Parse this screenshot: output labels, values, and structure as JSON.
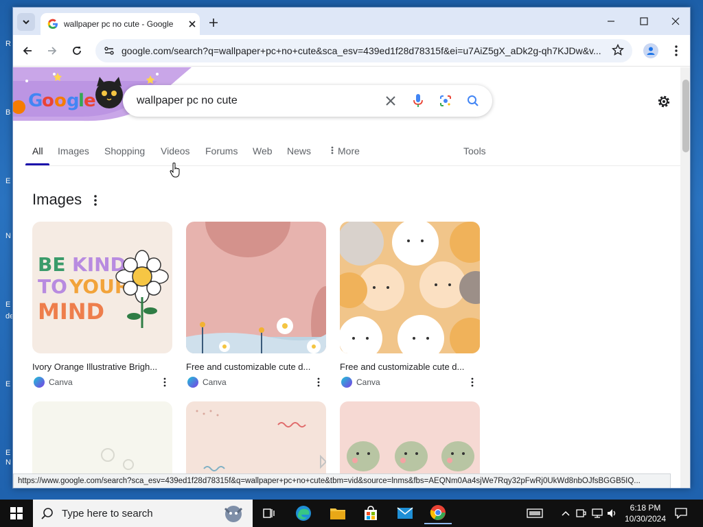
{
  "desktop": {
    "edge_letters": [
      "R",
      "B",
      "E",
      "N",
      "E",
      "de",
      "E",
      "E",
      "N"
    ]
  },
  "browser": {
    "tab_title": "wallpaper pc no cute - Google",
    "url": "google.com/search?q=wallpaper+pc+no+cute&sca_esv=439ed1f28d78315f&ei=u7AiZ5gX_aDk2g-qh7KJDw&v...",
    "status_url": "https://www.google.com/search?sca_esv=439ed1f28d78315f&q=wallpaper+pc+no+cute&tbm=vid&source=lnms&fbs=AEQNm0Aa4sjWe7Rqy32pFwRj0UkWd8nbOJfsBGGB5IQ..."
  },
  "search": {
    "query": "wallpaper pc no cute",
    "tabs": [
      "All",
      "Images",
      "Shopping",
      "Videos",
      "Forums",
      "Web",
      "News",
      "More"
    ],
    "tools_label": "Tools",
    "active_tab": "All"
  },
  "images_section": {
    "heading": "Images",
    "results": [
      {
        "title": "Ivory Orange Illustrative Brigh...",
        "source": "Canva"
      },
      {
        "title": "Free and customizable cute d...",
        "source": "Canva"
      },
      {
        "title": "Free and customizable cute d...",
        "source": "Canva"
      }
    ]
  },
  "taskbar": {
    "search_placeholder": "Type here to search",
    "time": "6:18 PM",
    "date": "10/30/2024"
  },
  "colors": {
    "google_blue": "#4285f4",
    "link_blue": "#1a0dab",
    "taskbar": "#101010"
  }
}
